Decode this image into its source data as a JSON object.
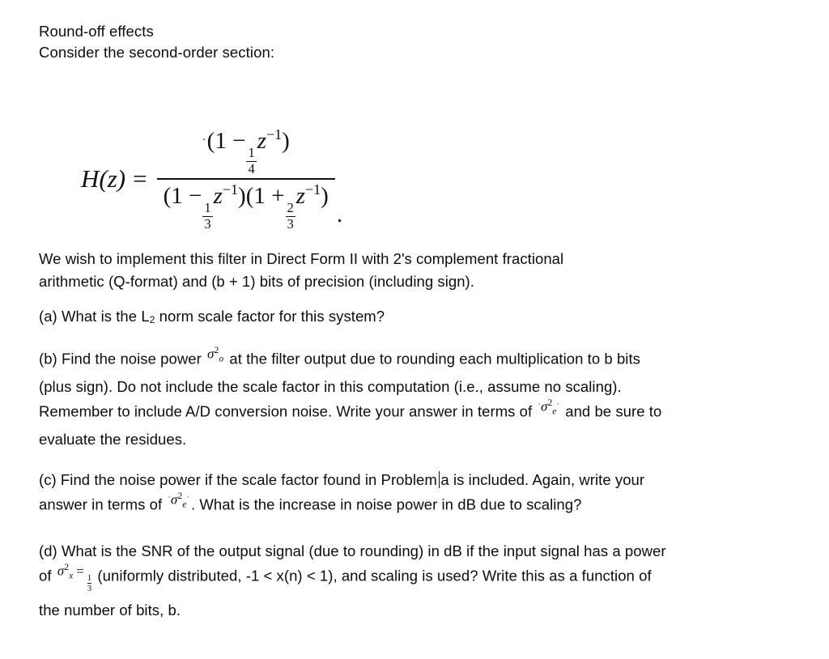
{
  "document": {
    "title_line": "Round-off effects",
    "intro_line": "Consider the second-order section:",
    "equation": {
      "lhs": "H(z)",
      "equals": "=",
      "leading_dot": "·",
      "numerator_plain": "(1 - 1/4 z^-1)",
      "denominator_plain": "(1 - 1/3 z^-1)(1 + 2/3 z^-1)",
      "trailing_dot": ".",
      "num": {
        "open": "(1 ",
        "minus": "−",
        "frac_num": "1",
        "frac_den": "4",
        "zvar": "z",
        "zexp": "−1",
        "close": ")"
      },
      "den": {
        "open1": "(1 ",
        "minus": "−",
        "f1_num": "1",
        "f1_den": "3",
        "zvar": "z",
        "zexp": "−1",
        "close1": ")",
        "open2": "(1 ",
        "plus": "+",
        "f2_num": "2",
        "f2_den": "3",
        "close2": ")"
      }
    },
    "paragraphs": {
      "implement_1": "We wish to implement this filter in Direct Form II with 2's complement fractional",
      "implement_2": "arithmetic (Q-format) and (b + 1) bits of precision (including sign).",
      "part_a": {
        "pre": "(a) What is the L",
        "sub": "2",
        "post": " norm scale factor for this system?"
      },
      "part_b": {
        "seg1": "(b) Find the noise power",
        "math1": {
          "sigma": "σ",
          "sup": "2",
          "sub": "o"
        },
        "seg2": "at the filter output due to rounding each multiplication to b bits",
        "seg3": "(plus sign). Do not include the scale factor in this computation (i.e., assume no scaling).",
        "seg4": "Remember to include A/D conversion noise. Write your answer in terms of",
        "math2": {
          "sigma": "σ",
          "sup": "2",
          "sub": "e"
        },
        "seg5": "and be sure to",
        "seg6": "evaluate the residues."
      },
      "part_c": {
        "seg1": "(c) Find the noise power if the scale factor found in Problem",
        "caret_word": "a",
        "seg2": "is included. Again, write your",
        "seg3": "answer in terms of",
        "math": {
          "sigma": "σ",
          "sup": "2",
          "sub": "e"
        },
        "seg4": ". What is the increase in noise power in dB due to scaling?"
      },
      "part_d": {
        "seg1": "(d) What is the SNR of the output signal (due to rounding) in dB if the input signal has a power",
        "seg2": "of",
        "math": {
          "sigma": "σ",
          "sup": "2",
          "sub": "x",
          "equals": "=",
          "frac_num": "1",
          "frac_den": "3"
        },
        "seg3": "(uniformly distributed, -1 < x(n) < 1), and scaling is used? Write this as a function of",
        "seg4": "the number of bits, b."
      }
    }
  },
  "colors": {
    "page_background": "#ffffff",
    "text": "#0d0d0d",
    "math": "#111111",
    "accent_dot": "#1a1ad0",
    "caret": "#111111"
  }
}
